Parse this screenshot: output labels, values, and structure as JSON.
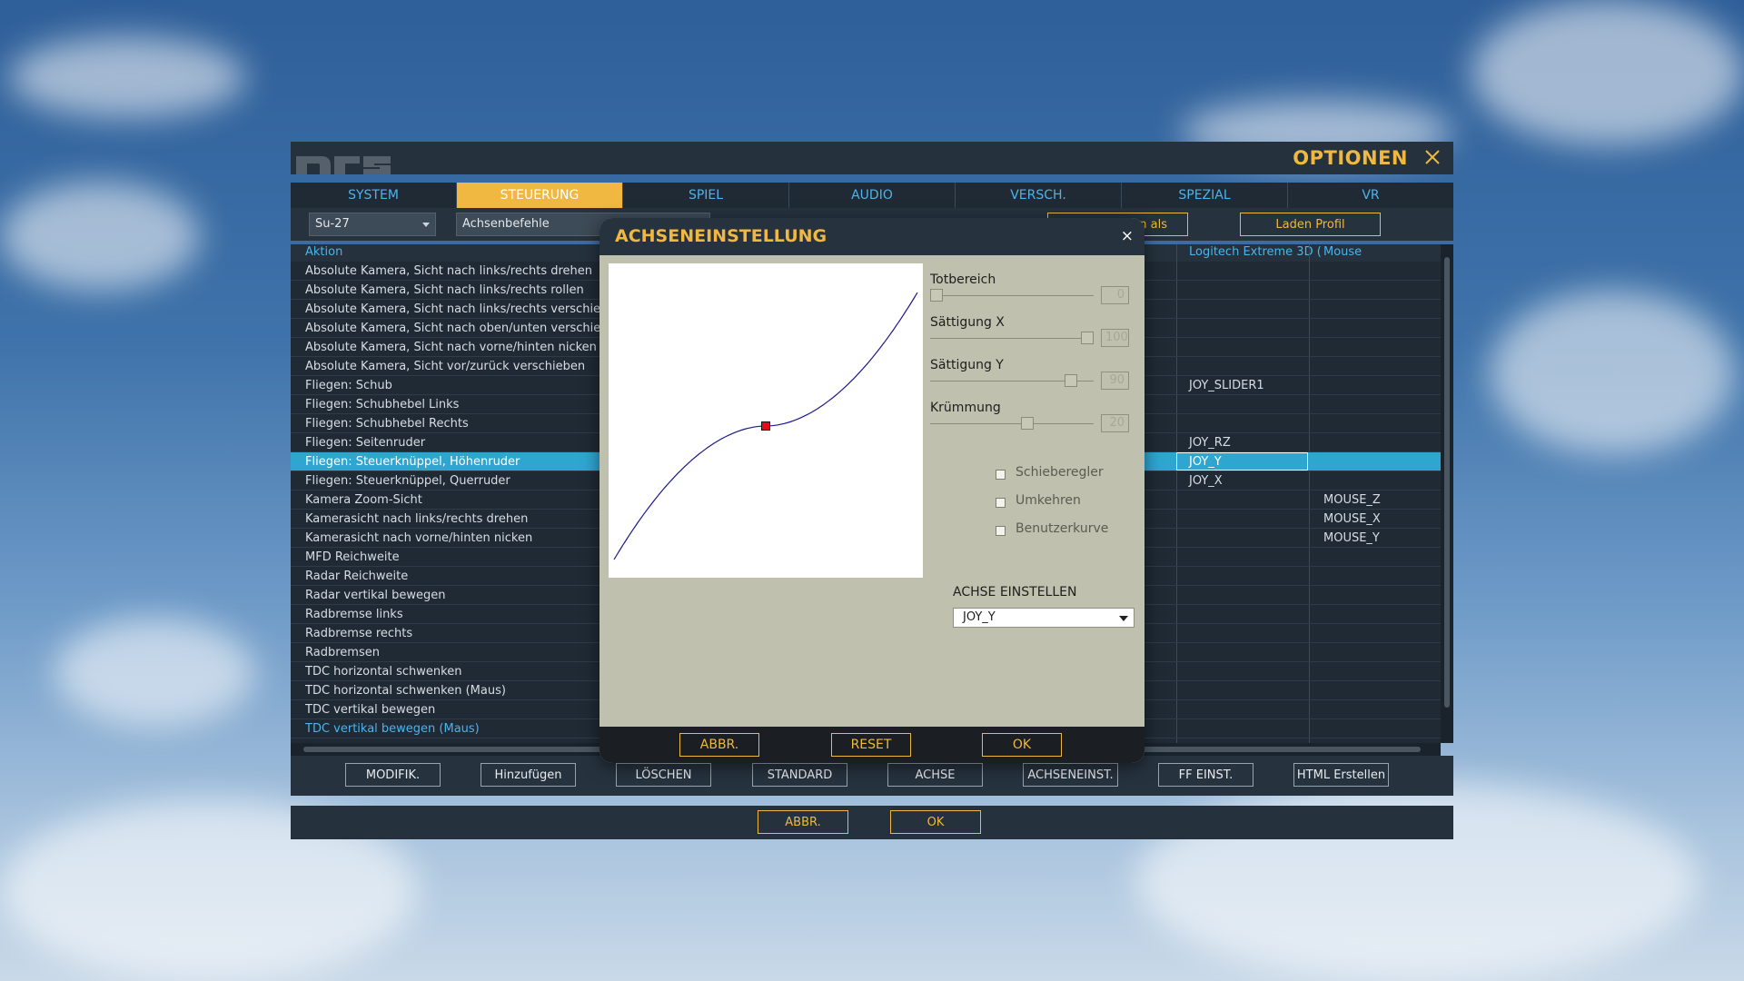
{
  "window": {
    "title": "OPTIONEN",
    "tabs": [
      {
        "label": "SYSTEM",
        "active": false
      },
      {
        "label": "STEUERUNG",
        "active": true
      },
      {
        "label": "SPIEL",
        "active": false
      },
      {
        "label": "AUDIO",
        "active": false
      },
      {
        "label": "VERSCH.",
        "active": false
      },
      {
        "label": "SPEZIAL",
        "active": false
      },
      {
        "label": "VR",
        "active": false
      }
    ],
    "toolbar": {
      "aircraft_select": "Su-27",
      "category_select": "Achsenbefehle",
      "save_as_button": "n als",
      "load_profile_button": "Laden Profil"
    },
    "table": {
      "columns": {
        "action": "Aktion",
        "joystick": "Logitech Extreme 3D (",
        "mouse": "Mouse"
      },
      "rows": [
        {
          "name": "Absolute Kamera, Sicht nach links/rechts drehen",
          "joy": "",
          "mouse": ""
        },
        {
          "name": "Absolute Kamera, Sicht nach links/rechts rollen",
          "joy": "",
          "mouse": ""
        },
        {
          "name": "Absolute Kamera, Sicht nach links/rechts verschieben",
          "joy": "",
          "mouse": ""
        },
        {
          "name": "Absolute Kamera, Sicht nach oben/unten verschieben",
          "joy": "",
          "mouse": ""
        },
        {
          "name": "Absolute Kamera, Sicht nach vorne/hinten nicken",
          "joy": "",
          "mouse": ""
        },
        {
          "name": "Absolute Kamera, Sicht vor/zurück verschieben",
          "joy": "",
          "mouse": ""
        },
        {
          "name": "Fliegen: Schub",
          "joy": "JOY_SLIDER1",
          "mouse": ""
        },
        {
          "name": "Fliegen: Schubhebel Links",
          "joy": "",
          "mouse": ""
        },
        {
          "name": "Fliegen: Schubhebel Rechts",
          "joy": "",
          "mouse": ""
        },
        {
          "name": "Fliegen: Seitenruder",
          "joy": "JOY_RZ",
          "mouse": ""
        },
        {
          "name": "Fliegen: Steuerknüppel, Höhenruder",
          "joy": "JOY_Y",
          "mouse": ""
        },
        {
          "name": "Fliegen: Steuerknüppel, Querruder",
          "joy": "JOY_X",
          "mouse": ""
        },
        {
          "name": "Kamera Zoom-Sicht",
          "joy": "",
          "mouse": "MOUSE_Z"
        },
        {
          "name": "Kamerasicht nach links/rechts drehen",
          "joy": "",
          "mouse": "MOUSE_X"
        },
        {
          "name": "Kamerasicht nach vorne/hinten nicken",
          "joy": "",
          "mouse": "MOUSE_Y"
        },
        {
          "name": "MFD Reichweite",
          "joy": "",
          "mouse": ""
        },
        {
          "name": "Radar Reichweite",
          "joy": "",
          "mouse": ""
        },
        {
          "name": "Radar vertikal bewegen",
          "joy": "",
          "mouse": ""
        },
        {
          "name": "Radbremse links",
          "joy": "",
          "mouse": ""
        },
        {
          "name": "Radbremse rechts",
          "joy": "",
          "mouse": ""
        },
        {
          "name": "Radbremsen",
          "joy": "",
          "mouse": ""
        },
        {
          "name": "TDC horizontal schwenken",
          "joy": "",
          "mouse": ""
        },
        {
          "name": "TDC horizontal schwenken (Maus)",
          "joy": "",
          "mouse": ""
        },
        {
          "name": "TDC vertikal bewegen",
          "joy": "",
          "mouse": ""
        },
        {
          "name": "TDC vertikal bewegen (Maus)",
          "joy": "",
          "mouse": ""
        }
      ],
      "selected_row_index": 10
    },
    "bottom_buttons": [
      "MODIFIK.",
      "Hinzufügen",
      "LÖSCHEN",
      "STANDARD",
      "ACHSE",
      "ACHSENEINST.",
      "FF EINST.",
      "HTML Erstellen"
    ],
    "footer_buttons": {
      "cancel": "ABBR.",
      "ok": "OK"
    }
  },
  "dialog": {
    "title": "ACHSENEINSTELLUNG",
    "close_glyph": "×",
    "sliders": {
      "deadzone": {
        "label": "Totbereich",
        "value": "0"
      },
      "saturation_x": {
        "label": "Sättigung X",
        "value": "100"
      },
      "saturation_y": {
        "label": "Sättigung Y",
        "value": "90"
      },
      "curvature": {
        "label": "Krümmung",
        "value": "20"
      }
    },
    "checkboxes": {
      "slider": {
        "label": "Schieberegler",
        "checked": false
      },
      "invert": {
        "label": "Umkehren",
        "checked": false
      },
      "user_curve": {
        "label": "Benutzerkurve",
        "checked": false
      }
    },
    "axis_label": "ACHSE EINSTELLEN",
    "axis_value": "JOY_Y",
    "buttons": {
      "cancel": "ABBR.",
      "reset": "RESET",
      "ok": "OK"
    }
  },
  "colors": {
    "accent": "#f0b840",
    "tab_text": "#4ab4ee",
    "selected_row": "#2fa6d0",
    "dialog_bg": "#bfc0ad",
    "curve": "#1a1a8a",
    "curve_marker": "#e01010"
  }
}
